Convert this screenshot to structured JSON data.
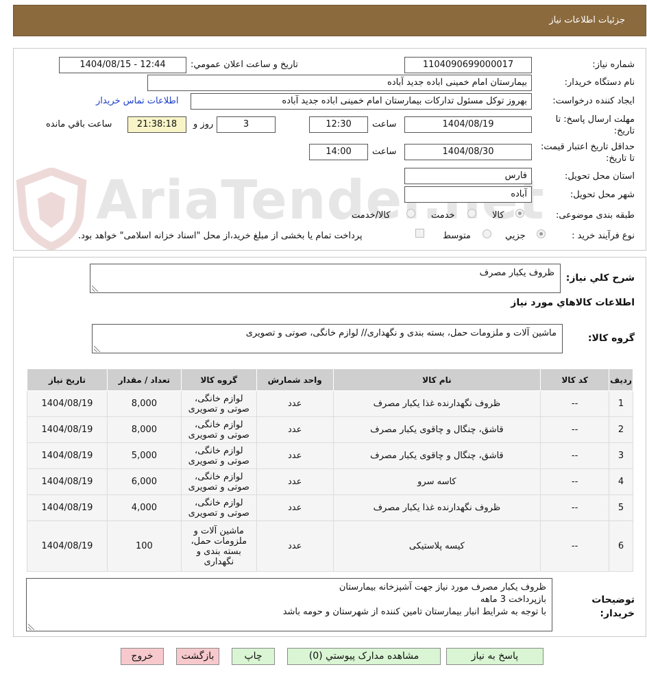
{
  "header": {
    "title": "جزئیات اطلاعات نیاز"
  },
  "form": {
    "need_number_label": "شماره نیاز:",
    "need_number": "1104090699000017",
    "announce_label": "تاريخ و ساعت اعلان عمومي:",
    "announce_value": "1404/08/15 - 12:44",
    "buyer_org_label": "نام دستگاه خريدار:",
    "buyer_org": "بیمارستان امام خمینی اباده جدید آباده",
    "creator_label": "ايجاد کننده درخواست:",
    "creator": "بهروز توکل مسئول تدارکات بیمارستان امام خمینی اباده جدید آباده",
    "contact_link": "اطلاعات تماس خريدار",
    "reply_deadline_label": "مهلت ارسال پاسخ: تا تاريخ:",
    "reply_date": "1404/08/19",
    "time_label": "ساعت",
    "reply_time": "12:30",
    "days_value": "3",
    "days_label": "روز و",
    "remaining_time": "21:38:18",
    "remaining_label": "ساعت باقي مانده",
    "price_validity_label": "حداقل تاريخ اعتبار قيمت: تا تاريخ:",
    "price_date": "1404/08/30",
    "price_time": "14:00",
    "province_label": "استان محل تحويل:",
    "province": "فارس",
    "city_label": "شهر محل تحويل:",
    "city": "آباده",
    "category_label": "طبقه بندی موضوعی:",
    "category_options": [
      "کالا",
      "خدمت",
      "کالا/خدمت"
    ],
    "purchase_type_label": "نوع فرآيند خريد :",
    "purchase_options": [
      "جزيي",
      "متوسط"
    ],
    "payment_note": "پرداخت تمام يا بخشی از مبلغ خريد،از محل \"اسناد خزانه اسلامی\" خواهد بود."
  },
  "summary": {
    "general_label": "شرح کلي نياز:",
    "general_value": "ظروف یکبار مصرف",
    "goods_info_title": "اطلاعات کالاهاي مورد نياز",
    "group_label": "گروه کالا:",
    "group_value": "ماشین آلات و ملزومات حمل، بسته بندی و نگهداری// لوازم خانگی، صوتی و تصویری"
  },
  "table": {
    "headers": [
      "رديف",
      "کد کالا",
      "نام کالا",
      "واحد شمارش",
      "گروه کالا",
      "تعداد / مقدار",
      "تاريخ نياز"
    ],
    "rows": [
      {
        "idx": "1",
        "code": "--",
        "name": "ظروف نگهدارنده غذا یکبار مصرف",
        "unit": "عدد",
        "group": "لوازم خانگی، صوتی و تصویری",
        "qty": "8,000",
        "date": "1404/08/19"
      },
      {
        "idx": "2",
        "code": "--",
        "name": "قاشق، چنگال و چاقوی یکبار مصرف",
        "unit": "عدد",
        "group": "لوازم خانگی، صوتی و تصویری",
        "qty": "8,000",
        "date": "1404/08/19"
      },
      {
        "idx": "3",
        "code": "--",
        "name": "قاشق، چنگال و چاقوی یکبار مصرف",
        "unit": "عدد",
        "group": "لوازم خانگی، صوتی و تصویری",
        "qty": "5,000",
        "date": "1404/08/19"
      },
      {
        "idx": "4",
        "code": "--",
        "name": "کاسه سرو",
        "unit": "عدد",
        "group": "لوازم خانگی، صوتی و تصویری",
        "qty": "6,000",
        "date": "1404/08/19"
      },
      {
        "idx": "5",
        "code": "--",
        "name": "ظروف نگهدارنده غذا یکبار مصرف",
        "unit": "عدد",
        "group": "لوازم خانگی، صوتی و تصویری",
        "qty": "4,000",
        "date": "1404/08/19"
      },
      {
        "idx": "6",
        "code": "--",
        "name": "کیسه پلاستیکی",
        "unit": "عدد",
        "group": "ماشین آلات و ملزومات حمل، بسته بندی و نگهداری",
        "qty": "100",
        "date": "1404/08/19"
      }
    ]
  },
  "notes": {
    "label": "توضيحات خريدار:",
    "lines": [
      "ظروف یکبار مصرف مورد نیاز جهت آشپزخانه بیمارستان",
      "بازپرداخت 3 ماهه",
      "با توجه به شرایط انبار بیمارستان تامین کننده از شهرستان و حومه باشد"
    ]
  },
  "buttons": {
    "reply": "پاسخ به نياز",
    "attachments": "مشاهده مدارک پيوستي (0)",
    "print": "چاپ",
    "back": "بازگشت",
    "exit": "خروج"
  },
  "watermark": {
    "text": "AriaTender.net"
  }
}
